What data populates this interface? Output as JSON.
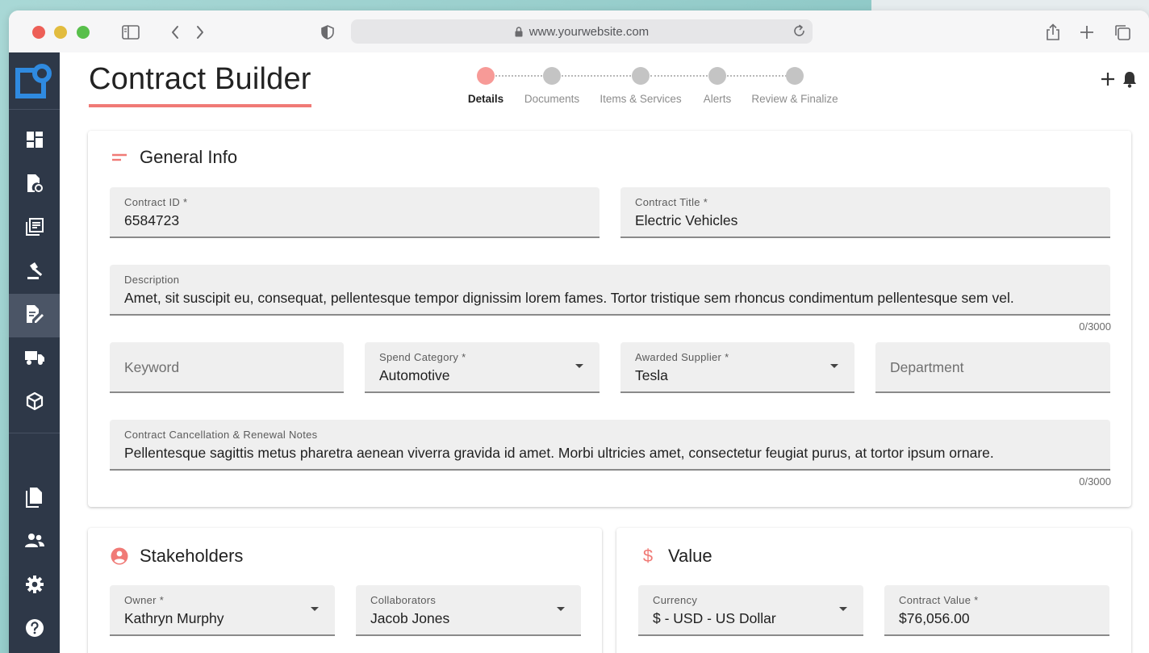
{
  "browser": {
    "url": "www.yourwebsite.com"
  },
  "page": {
    "title": "Contract Builder"
  },
  "stepper": {
    "steps": [
      {
        "label": "Details",
        "active": true
      },
      {
        "label": "Documents",
        "active": false
      },
      {
        "label": "Items & Services",
        "active": false
      },
      {
        "label": "Alerts",
        "active": false
      },
      {
        "label": "Review & Finalize",
        "active": false
      }
    ]
  },
  "sidebar": {
    "items": [
      {
        "icon": "dashboard-icon"
      },
      {
        "icon": "document-settings-icon"
      },
      {
        "icon": "library-icon"
      },
      {
        "icon": "gavel-icon"
      },
      {
        "icon": "edit-document-icon",
        "active": true
      },
      {
        "icon": "truck-icon"
      },
      {
        "icon": "package-icon"
      },
      {
        "icon": "files-icon"
      },
      {
        "icon": "people-icon"
      },
      {
        "icon": "gear-icon"
      },
      {
        "icon": "help-icon"
      }
    ]
  },
  "general_info": {
    "title": "General Info",
    "contract_id": {
      "label": "Contract ID *",
      "value": "6584723"
    },
    "contract_title": {
      "label": "Contract Title *",
      "value": "Electric Vehicles"
    },
    "description": {
      "label": "Description",
      "value": "Amet, sit suscipit eu, consequat, pellentesque tempor dignissim lorem fames. Tortor tristique sem rhoncus condimentum pellentesque sem vel.",
      "counter": "0/3000"
    },
    "keyword": {
      "placeholder": "Keyword"
    },
    "spend_category": {
      "label": "Spend Category *",
      "value": "Automotive"
    },
    "awarded_supplier": {
      "label": "Awarded Supplier *",
      "value": "Tesla"
    },
    "department": {
      "placeholder": "Department"
    },
    "notes": {
      "label": "Contract Cancellation & Renewal Notes",
      "value": "Pellentesque sagittis metus pharetra aenean viverra gravida id amet. Morbi ultricies amet, consectetur feugiat purus, at tortor ipsum ornare.",
      "counter": "0/3000"
    }
  },
  "stakeholders": {
    "title": "Stakeholders",
    "owner": {
      "label": "Owner *",
      "value": "Kathryn Murphy"
    },
    "collaborators": {
      "label": "Collaborators",
      "value": "Jacob Jones"
    }
  },
  "value_card": {
    "title": "Value",
    "currency": {
      "label": "Currency",
      "value": "$ - USD - US Dollar"
    },
    "contract_value": {
      "label": "Contract Value *",
      "value": "$76,056.00"
    }
  },
  "colors": {
    "accent": "#f07a76",
    "sidebar": "#2e3848",
    "logo": "#2f8ae0"
  }
}
